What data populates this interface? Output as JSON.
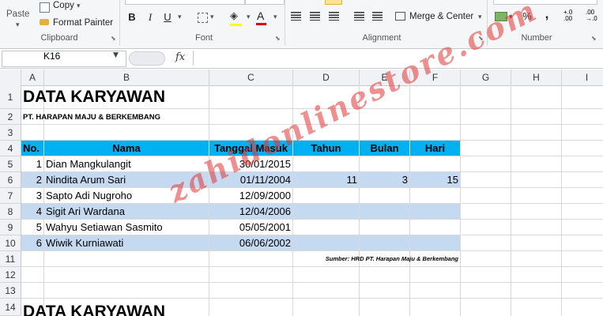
{
  "ribbon": {
    "clipboard": {
      "paste_label": "Paste",
      "copy_label": "Copy",
      "format_painter_label": "Format Painter",
      "group_label": "Clipboard"
    },
    "font": {
      "bold": "B",
      "italic": "I",
      "underline": "U",
      "group_label": "Font"
    },
    "alignment": {
      "merge_center_label": "Merge & Center",
      "group_label": "Alignment"
    },
    "number": {
      "percent": "%",
      "comma": ",",
      "inc_decimal": "+.0\n.00",
      "dec_decimal": ".00\n→.0",
      "group_label": "Number"
    }
  },
  "formula_bar": {
    "name_box": "K16",
    "fx_label": "fx",
    "formula": ""
  },
  "columns": [
    "A",
    "B",
    "C",
    "D",
    "E",
    "F",
    "G",
    "H",
    "I"
  ],
  "rows": [
    "1",
    "2",
    "3",
    "4",
    "5",
    "6",
    "7",
    "8",
    "9",
    "10",
    "11",
    "12",
    "13",
    "14"
  ],
  "sheet": {
    "title": "DATA KARYAWAN",
    "subtitle": "PT. HARAPAN MAJU & BERKEMBANG",
    "headers": {
      "no": "No.",
      "nama": "Nama",
      "tanggal": "Tanggal Masuk",
      "tahun": "Tahun",
      "bulan": "Bulan",
      "hari": "Hari"
    },
    "employees": [
      {
        "no": "1",
        "nama": "Dian Mangkulangit",
        "tanggal": "30/01/2015",
        "tahun": "",
        "bulan": "",
        "hari": ""
      },
      {
        "no": "2",
        "nama": "Nindita Arum Sari",
        "tanggal": "01/11/2004",
        "tahun": "11",
        "bulan": "3",
        "hari": "15"
      },
      {
        "no": "3",
        "nama": "Sapto Adi Nugroho",
        "tanggal": "12/09/2000",
        "tahun": "",
        "bulan": "",
        "hari": ""
      },
      {
        "no": "4",
        "nama": "Sigit Ari Wardana",
        "tanggal": "12/04/2006",
        "tahun": "",
        "bulan": "",
        "hari": ""
      },
      {
        "no": "5",
        "nama": "Wahyu Setiawan Sasmito",
        "tanggal": "05/05/2001",
        "tahun": "",
        "bulan": "",
        "hari": ""
      },
      {
        "no": "6",
        "nama": "Wiwik Kurniawati",
        "tanggal": "06/06/2002",
        "tahun": "",
        "bulan": "",
        "hari": ""
      }
    ],
    "source_note": "Sumber: HRD PT. Harapan Maju & Berkembang",
    "title_repeat": "DATA KARYAWAN"
  },
  "watermark": "zahidonlinestore.com",
  "colors": {
    "header_fill": "#00b0f0",
    "band_fill": "#c5d9f1",
    "watermark": "#e23434"
  }
}
